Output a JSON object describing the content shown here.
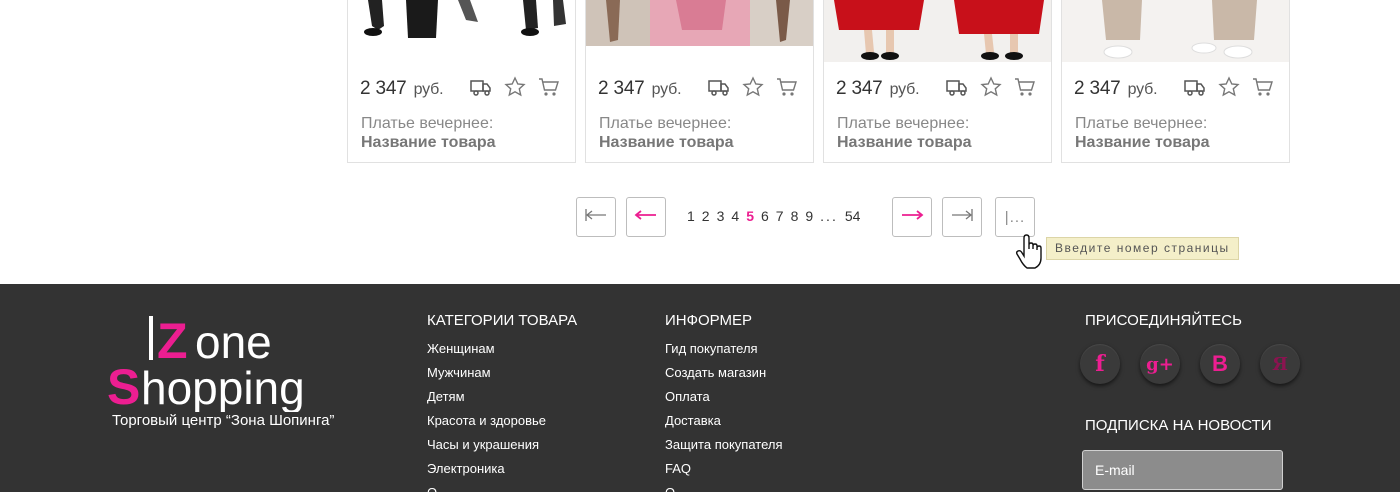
{
  "products": [
    {
      "price": "2 347",
      "currency": "руб.",
      "category": "Платье вечернее:",
      "name": "Название товара"
    },
    {
      "price": "2 347",
      "currency": "руб.",
      "category": "Платье вечернее:",
      "name": "Название товара"
    },
    {
      "price": "2 347",
      "currency": "руб.",
      "category": "Платье вечернее:",
      "name": "Название товара"
    },
    {
      "price": "2 347",
      "currency": "руб.",
      "category": "Платье вечернее:",
      "name": "Название товара"
    }
  ],
  "card_icons": [
    "delivery-truck-icon",
    "star-icon",
    "cart-icon"
  ],
  "pagination": {
    "first_icon": "first-page-icon",
    "prev_icon": "prev-arrow-icon",
    "pages": [
      "1",
      "2",
      "3",
      "4",
      "5",
      "6",
      "7",
      "8",
      "9"
    ],
    "current": "5",
    "ellipsis": "...",
    "last_page": "54",
    "next_icon": "next-arrow-icon",
    "last_icon": "last-page-icon",
    "goto_label": "|...",
    "tooltip": "Введите номер страницы"
  },
  "footer": {
    "logo": {
      "text": "Zone Shopping"
    },
    "logo_caption": "Торговый центр “Зона Шопинга”",
    "categories": {
      "title": "КАТЕГОРИИ ТОВАРА",
      "items": [
        "Женщинам",
        "Мужчинам",
        "Детям",
        "Красота и здоровье",
        "Часы и украшения",
        "Электроника",
        "О"
      ]
    },
    "informer": {
      "title": "ИНФОРМЕР",
      "items": [
        "Гид покупателя",
        "Создать магазин",
        "Оплата",
        "Доставка",
        "Защита покупателя",
        "FAQ",
        "О"
      ]
    },
    "join_title": "ПРИСОЕДИНЯЙТЕСЬ",
    "social": [
      {
        "icon": "facebook-icon",
        "glyph": "f"
      },
      {
        "icon": "google-plus-icon",
        "glyph": "g+"
      },
      {
        "icon": "vkontakte-icon",
        "glyph": "B"
      },
      {
        "icon": "yandex-icon",
        "glyph": "Я"
      }
    ],
    "subscribe_title": "ПОДПИСКА НА НОВОСТИ",
    "email_placeholder": "E-mail"
  },
  "colors": {
    "accent": "#ec1e91",
    "footer_bg": "#333333",
    "tooltip_bg": "#f4efc9"
  }
}
